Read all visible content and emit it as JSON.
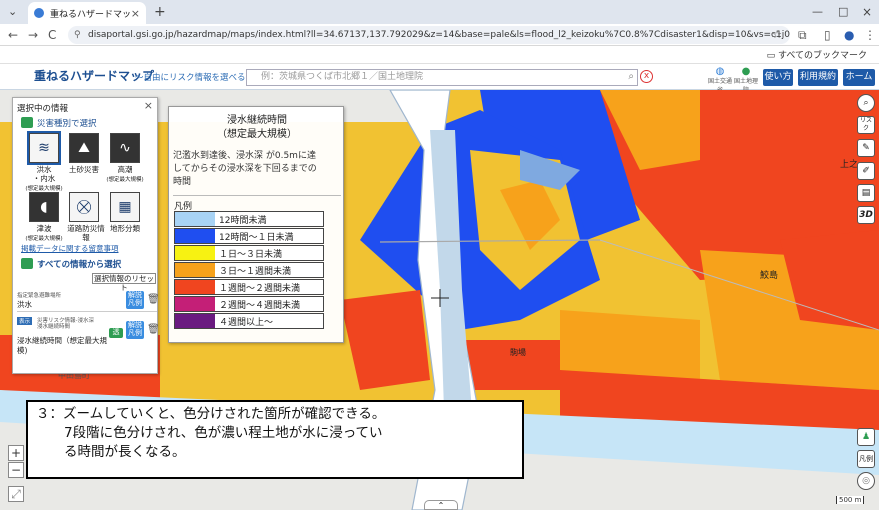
{
  "browser": {
    "tab_title": "重ねるハザードマップ",
    "url": "disaportal.gsi.go.jp/hazardmap/maps/index.html?ll=34.67137,137.792029&z=14&base=pale&ls=flood_l2_keizoku%7C0.8%7Cdisaster1&disp=10&vs=c1j0l0u0t0h0z0",
    "bookmarks_label": "すべてのブックマーク",
    "new_tab": "+",
    "close": "×",
    "chevron": "⌄",
    "back": "←",
    "fwd": "→",
    "reload": "C",
    "menu": "⋮",
    "minimize": "—",
    "maximize": "□"
  },
  "header": {
    "logo": "重ねるハザードマップ",
    "tagline": "～自由にリスク情報を選べる～",
    "search_placeholder": "例：茨城県つくば市北郷１／国土地理院",
    "clear": "x",
    "org1": "国土交通省",
    "org2": "国土地理院",
    "btn_usage": "使い方",
    "btn_terms": "利用規約",
    "btn_home": "ホーム"
  },
  "selected_panel": {
    "title": "選択中の情報",
    "close": "×",
    "by_disaster": "災害種別で選択",
    "disasters": [
      {
        "label": "洪水",
        "sub": "・内水",
        "note": "(想定最大規模)"
      },
      {
        "label": "土砂災害",
        "sub": "",
        "note": ""
      },
      {
        "label": "高潮",
        "sub": "",
        "note": "(想定最大規模)"
      },
      {
        "label": "津波",
        "sub": "",
        "note": "(想定最大規模)"
      },
      {
        "label": "道路防災情報",
        "sub": "",
        "note": ""
      },
      {
        "label": "地形分類",
        "sub": "",
        "note": ""
      }
    ],
    "note_link": "掲載データに関する留意事項",
    "all_info": "すべての情報から選択",
    "reset": "選択情報のリセット",
    "items": [
      {
        "tag": "指定緊急避難場所",
        "name": "洪水"
      },
      {
        "tag": "災害リスク情報-浸水深",
        "tag2": "浸水継続時間",
        "name": "浸水継続時間（想定最大規模)"
      }
    ],
    "legend_tag": "凡例",
    "desc_tag": "解説"
  },
  "legend": {
    "title": "浸水継続時間",
    "subtitle": "（想定最大規模）",
    "desc1": "氾濫水到達後、浸水深 が0.5mに達",
    "desc2": "してからその浸水深を下回るまでの",
    "desc3": "時間",
    "heading": "凡例",
    "rows": [
      {
        "label": "12時間未満",
        "color": "#a8d3f5"
      },
      {
        "label": "12時間～１日未満",
        "color": "#1f4ef0"
      },
      {
        "label": "１日～３日未満",
        "color": "#f7f212"
      },
      {
        "label": "３日～１週間未満",
        "color": "#f7a21b"
      },
      {
        "label": "１週間～２週間未満",
        "color": "#f0451f"
      },
      {
        "label": "２週間～４週間未満",
        "color": "#c41f77"
      },
      {
        "label": "４週間以上～",
        "color": "#6a1a80"
      }
    ]
  },
  "map_labels": {
    "place1": "上之",
    "place2": "鮫島",
    "place3": "駒場",
    "place4": "中田島町",
    "plus": "+",
    "minus": "−",
    "legend_btn": "凡例",
    "risk_btn": "リスク",
    "btn_3d": "3D",
    "scale": "500 m"
  },
  "caption": {
    "line1": "３：ズームしていくと、色分けされた箇所が確認できる。",
    "line2": "7段階に色分けされ、色が濃い程土地が水に浸ってい",
    "line3": "る時間が長くなる。"
  }
}
